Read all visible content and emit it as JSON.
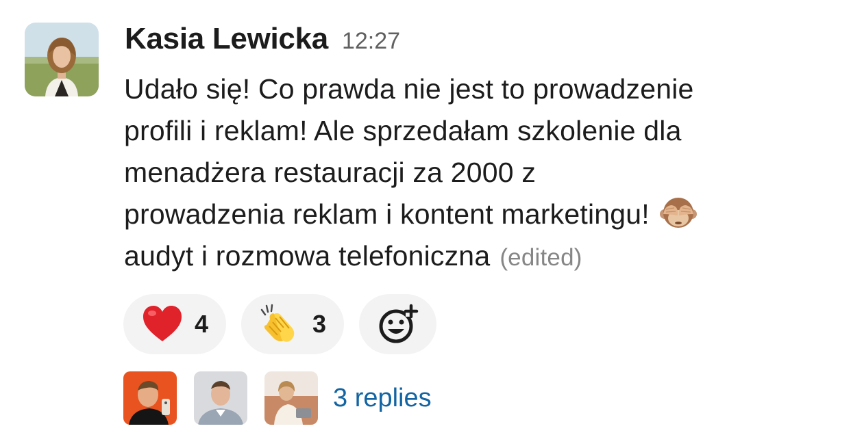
{
  "message": {
    "author": "Kasia Lewicka",
    "time": "12:27",
    "lines": [
      "Udało się! Co prawda nie jest to prowadzenie",
      "profili i reklam! Ale sprzedałam szkolenie dla",
      "menadżera restauracji za 2000  z",
      "prowadzenia reklam i kontent marketingu!",
      "audyt i rozmowa telefoniczna"
    ],
    "edited_label": "(edited)",
    "inline_emoji": "see-no-evil-monkey-icon"
  },
  "reactions": [
    {
      "emoji": "red-heart-icon",
      "count": "4"
    },
    {
      "emoji": "clapping-hands-icon",
      "count": "3"
    }
  ],
  "add_reaction": {
    "icon": "add-reaction-icon"
  },
  "thread": {
    "replies_label": "3 replies",
    "participant_avatars": [
      "avatar-1",
      "avatar-2",
      "avatar-3"
    ]
  },
  "colors": {
    "text": "#1d1c1d",
    "muted": "#616061",
    "link": "#1264a3",
    "reaction_bg": "#f4f3f3"
  }
}
